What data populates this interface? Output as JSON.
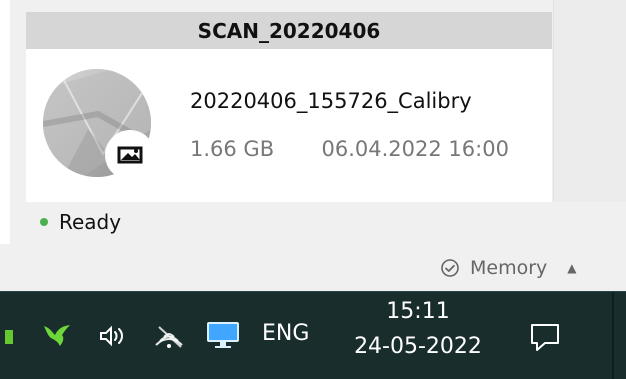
{
  "card": {
    "title": "SCAN_20220406",
    "file_name": "20220406_155726_Calibry",
    "file_size": "1.66 GB",
    "file_datetime": "06.04.2022 16:00"
  },
  "status": {
    "text": "Ready",
    "color": "#4caf50"
  },
  "footer": {
    "memory_label": "Memory"
  },
  "taskbar": {
    "language": "ENG",
    "time": "15:11",
    "date": "24-05-2022",
    "icons": [
      "app-icon",
      "bird-icon",
      "speaker-icon",
      "wifi-icon",
      "monitor-icon",
      "notification-icon"
    ],
    "colors": {
      "background": "#192d2d",
      "bird": "#6fd63a",
      "monitor": "#41a6ff"
    }
  }
}
